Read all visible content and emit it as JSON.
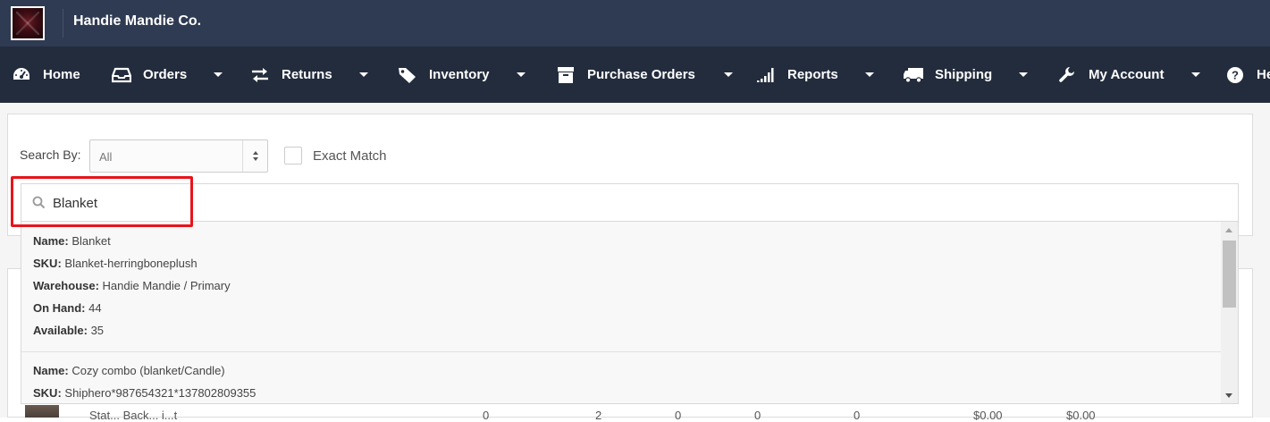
{
  "header": {
    "company": "Handie Mandie Co."
  },
  "nav": [
    {
      "label": "Home",
      "icon": "dashboard-icon",
      "caret": false
    },
    {
      "label": "Orders",
      "icon": "inbox-icon",
      "caret": true
    },
    {
      "label": "Returns",
      "icon": "exchange-icon",
      "caret": true
    },
    {
      "label": "Inventory",
      "icon": "tag-icon",
      "caret": true
    },
    {
      "label": "Purchase Orders",
      "icon": "archive-icon",
      "caret": true
    },
    {
      "label": "Reports",
      "icon": "signal-icon",
      "caret": true
    },
    {
      "label": "Shipping",
      "icon": "truck-icon",
      "caret": true
    },
    {
      "label": "My Account",
      "icon": "wrench-icon",
      "caret": true
    },
    {
      "label": "He",
      "icon": "help-icon",
      "caret": false
    }
  ],
  "search": {
    "search_by_label": "Search By:",
    "search_by_value": "All",
    "exact_match_label": "Exact Match",
    "query": "Blanket"
  },
  "results": [
    {
      "name_label": "Name:",
      "name": "Blanket",
      "sku_label": "SKU:",
      "sku": "Blanket-herringboneplush",
      "warehouse_label": "Warehouse:",
      "warehouse": "Handie Mandie / Primary",
      "on_hand_label": "On Hand:",
      "on_hand": "44",
      "available_label": "Available:",
      "available": "35"
    },
    {
      "name_label": "Name:",
      "name": "Cozy combo (blanket/Candle)",
      "sku_label": "SKU:",
      "sku": "Shiphero*987654321*137802809355"
    }
  ],
  "table_peek": {
    "product": "Stat... Back... i...t",
    "cells": [
      "0",
      "2",
      "0",
      "0",
      "0",
      "$0.00",
      "$0.00"
    ]
  },
  "colors": {
    "topbar": "#2f3b52",
    "navbar": "#232c3d",
    "highlight": "#e8141c"
  }
}
